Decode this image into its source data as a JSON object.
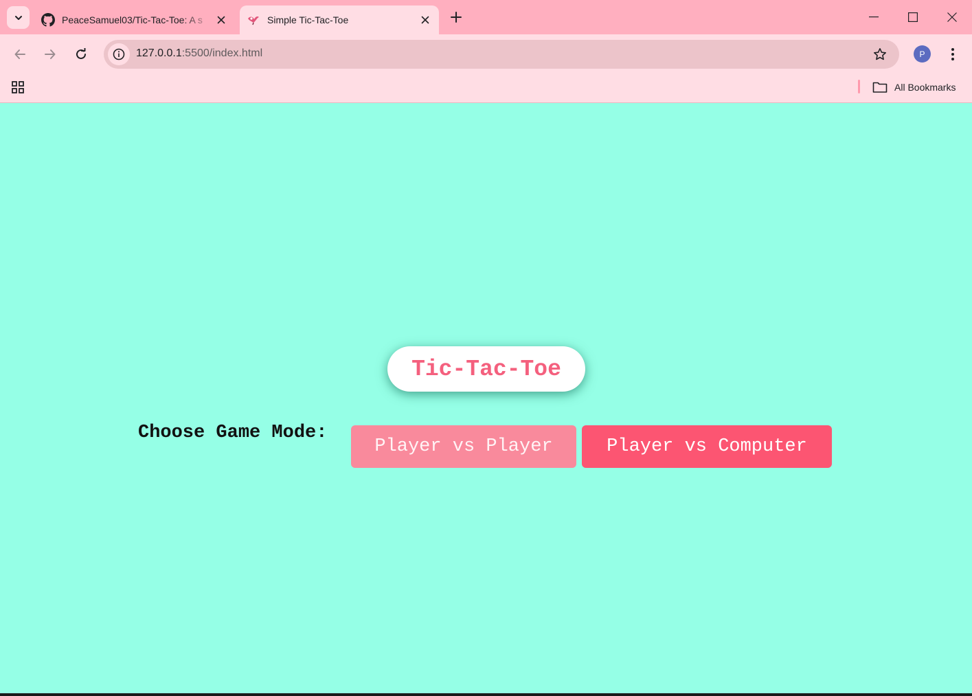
{
  "browser": {
    "tabs": [
      {
        "title": "PeaceSamuel03/Tic-Tac-Toe: A s",
        "icon": "github-icon",
        "active": false
      },
      {
        "title": "Simple Tic-Tac-Toe",
        "icon": "bird-icon",
        "active": true
      }
    ],
    "url_host": "127.0.0.1",
    "url_path": ":5500/index.html",
    "profile_initial": "P",
    "bookmarks_label": "All Bookmarks",
    "colors": {
      "tabstrip": "#ffafbf",
      "toolbar": "#ffdde4",
      "omnibox": "#ecc4ca"
    }
  },
  "page": {
    "title": "Tic-Tac-Toe",
    "mode_label": "Choose Game Mode:",
    "buttons": {
      "pvp": "Player vs Player",
      "pvc": "Player vs Computer"
    },
    "colors": {
      "background": "#95ffe6",
      "title_text": "#f4607e",
      "pvp_button": "#f98a9c",
      "pvc_button": "#fc5572"
    }
  }
}
